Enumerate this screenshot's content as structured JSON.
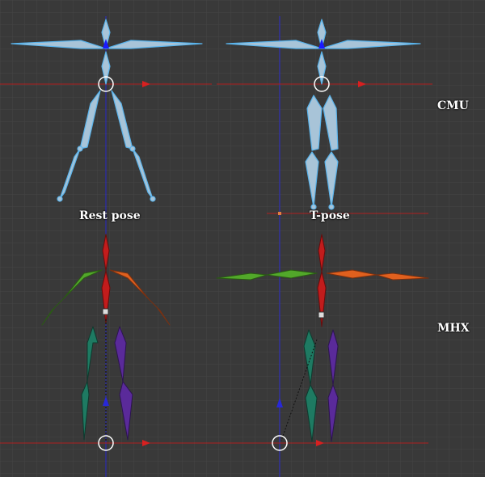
{
  "labels": {
    "rest_pose": "Rest pose",
    "t_pose": "T-pose",
    "cmu": "CMU",
    "mhx": "MHX"
  },
  "colors": {
    "background": "#393939",
    "grid": "#454545",
    "x_axis": "#b02020",
    "y_axis": "#2828c8",
    "cmu_bone": "#a8c4d8",
    "cmu_outline": "#5ab4ec",
    "mhx_spine": "#c21c1c",
    "mhx_left_arm": "#52a82a",
    "mhx_right_arm": "#e0601e",
    "mhx_left_leg": "#1e7a62",
    "mhx_right_leg": "#5a2a9a"
  }
}
